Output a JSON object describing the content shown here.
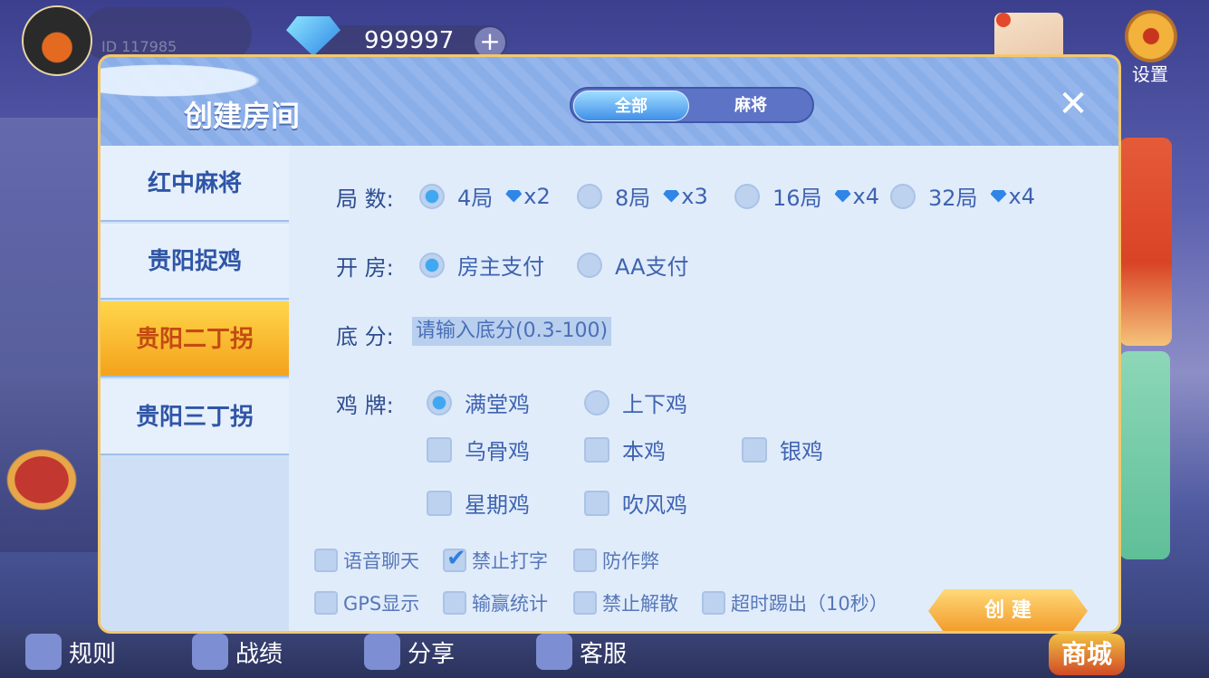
{
  "topbar": {
    "id_text": "ID 117985",
    "diamond_count": "999997",
    "plus_label": "+",
    "settings_label": "设置"
  },
  "dialog": {
    "title": "创建房间",
    "tabs": [
      {
        "label": "全部"
      },
      {
        "label": "麻将"
      }
    ],
    "close_label": "✕"
  },
  "sidebar": {
    "items": [
      {
        "label": "红中麻将"
      },
      {
        "label": "贵阳捉鸡"
      },
      {
        "label": "贵阳二丁拐"
      },
      {
        "label": "贵阳三丁拐"
      }
    ]
  },
  "form": {
    "rounds": {
      "label": "局  数:",
      "options": [
        {
          "label": "4局",
          "cost": "x2",
          "selected": true
        },
        {
          "label": "8局",
          "cost": "x3",
          "selected": false
        },
        {
          "label": "16局",
          "cost": "x4",
          "selected": false
        },
        {
          "label": "32局",
          "cost": "x4",
          "selected": false
        }
      ]
    },
    "payment": {
      "label": "开  房:",
      "options": [
        {
          "label": "房主支付",
          "selected": true
        },
        {
          "label": "AA支付",
          "selected": false
        }
      ]
    },
    "base_score": {
      "label": "底  分:",
      "placeholder": "请输入底分(0.3-100)"
    },
    "chicken": {
      "label": "鸡  牌:",
      "options": [
        {
          "label": "满堂鸡",
          "selected": true
        },
        {
          "label": "上下鸡",
          "selected": false
        }
      ],
      "checks": [
        {
          "label": "乌骨鸡",
          "checked": false
        },
        {
          "label": "本鸡",
          "checked": false
        },
        {
          "label": "银鸡",
          "checked": false
        },
        {
          "label": "星期鸡",
          "checked": false
        },
        {
          "label": "吹风鸡",
          "checked": false
        }
      ]
    },
    "extras": [
      {
        "label": "语音聊天",
        "checked": false
      },
      {
        "label": "禁止打字",
        "checked": true
      },
      {
        "label": "防作弊",
        "checked": false
      },
      {
        "label": "GPS显示",
        "checked": false
      },
      {
        "label": "输赢统计",
        "checked": false
      },
      {
        "label": "禁止解散",
        "checked": false
      },
      {
        "label": "超时踢出（10秒）",
        "checked": false
      }
    ],
    "create_label": "创 建"
  },
  "bottom_nav": {
    "items": [
      {
        "label": "规则"
      },
      {
        "label": "战绩"
      },
      {
        "label": "分享"
      },
      {
        "label": "客服"
      }
    ],
    "shop_label": "商城"
  },
  "colors": {
    "accent": "#3f8fe8",
    "active_tab": "#f4a21c",
    "border_gold": "#f3c86b"
  }
}
